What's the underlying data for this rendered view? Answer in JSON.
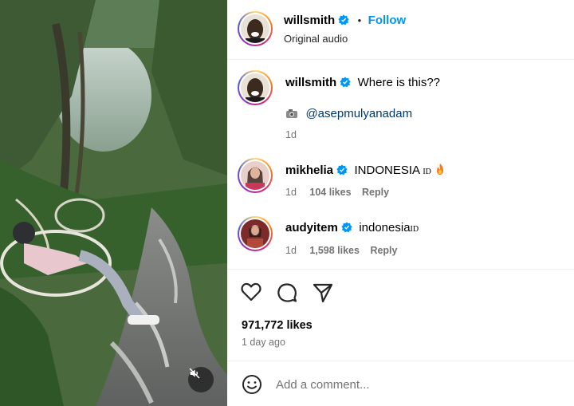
{
  "post": {
    "author": "willsmith",
    "follow_label": "Follow",
    "separator": "•",
    "audio": "Original audio"
  },
  "caption": {
    "author": "willsmith",
    "text": "Where is this??",
    "mention_icon": "camera-emoji",
    "mention": "@asepmulyanadam",
    "time": "1d"
  },
  "comments": [
    {
      "author": "mikhelia",
      "text": "INDONESIA ",
      "flag": "ID",
      "emoji": "fire-emoji",
      "time": "1d",
      "likes": "104 likes",
      "reply_label": "Reply"
    },
    {
      "author": "audyitem",
      "text": "indonesia",
      "flag": "ID",
      "time": "1d",
      "likes": "1,598 likes",
      "reply_label": "Reply"
    }
  ],
  "stats": {
    "likes": "971,772 likes",
    "posted": "1 day ago"
  },
  "composer": {
    "placeholder": "Add a comment..."
  },
  "colors": {
    "accent": "#0095f6",
    "mention": "#00376b",
    "muted": "#737373",
    "verified": "#0095f6"
  }
}
